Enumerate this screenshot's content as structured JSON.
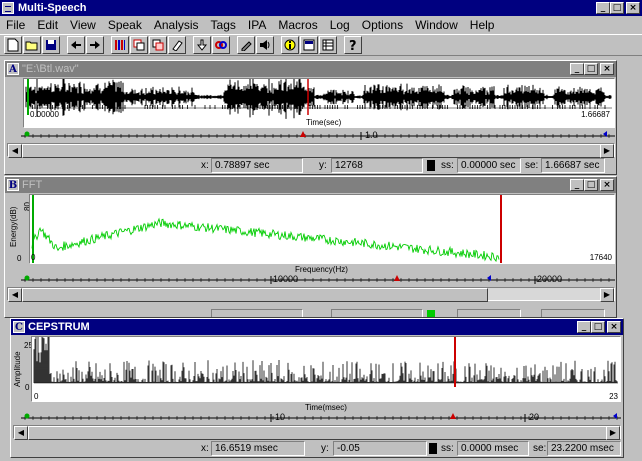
{
  "app": {
    "title": "Multi-Speech"
  },
  "window_buttons": {
    "min": "_",
    "max": "□",
    "close": "×"
  },
  "menu": [
    "File",
    "Edit",
    "View",
    "Speak",
    "Analysis",
    "Tags",
    "IPA",
    "Macros",
    "Log",
    "Options",
    "Window",
    "Help"
  ],
  "toolbar_icons": [
    "new-file-icon",
    "open-folder-icon",
    "save-icon",
    "back-arrow-icon",
    "forward-arrow-icon",
    "spectrogram-icon",
    "copy-window-icon",
    "close-window-icon",
    "eraser-icon",
    "download-icon",
    "link-icon",
    "pen-icon",
    "speaker-icon",
    "info-icon",
    "display-icon",
    "table-icon",
    "help-icon"
  ],
  "panels": {
    "a": {
      "letter": "A",
      "title": "\"E:\\Btl.wav\"",
      "x_start": "0.00000",
      "x_end": "1.66687",
      "x_label": "Time(sec)",
      "ruler_mid": "1.0",
      "status": {
        "x_label": "x:",
        "x_value": "0.78897 sec",
        "y_label": "y:",
        "y_value": "12768",
        "ss_label": "ss:",
        "ss_value": "0.00000 sec",
        "se_label": "se:",
        "se_value": "1.66687 sec"
      }
    },
    "b": {
      "letter": "B",
      "title": "FFT",
      "y_label": "Energy(dB)",
      "y_top": "80",
      "y_bottom": "0",
      "x_start": "0",
      "x_end": "17640",
      "x_label": "Frequency(Hz)",
      "ruler_ticks": [
        "10000",
        "20000"
      ]
    },
    "c": {
      "letter": "C",
      "title": "CEPSTRUM",
      "y_label": "Amplitude",
      "y_top": "25",
      "y_bottom": "0",
      "x_start": "0",
      "x_end": "23",
      "x_label": "Time(msec)",
      "ruler_ticks": [
        "10",
        "20"
      ],
      "status": {
        "x_label": "x:",
        "x_value": "16.6519 msec",
        "y_label": "y:",
        "y_value": "-0.05",
        "ss_label": "ss:",
        "ss_value": "0.0000 msec",
        "se_label": "se:",
        "se_value": "23.2200 msec"
      }
    }
  },
  "colors": {
    "titlebar_active": "#000080",
    "titlebar_inactive": "#808080",
    "fft_line": "#00cc00",
    "cursor": "#cc0000",
    "start_marker": "#00aa00"
  }
}
